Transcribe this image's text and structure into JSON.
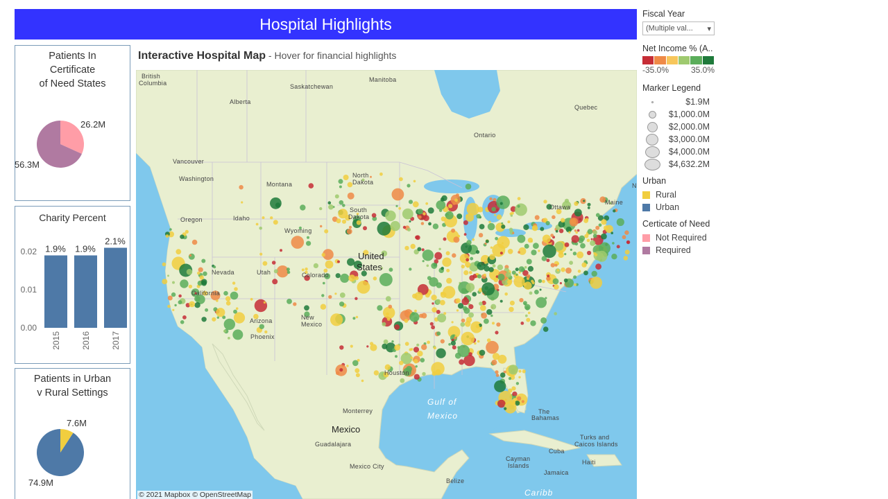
{
  "header": {
    "title": "Hospital Highlights"
  },
  "panels": {
    "certificate": {
      "title_lines": [
        "Patients In",
        "Certificate",
        "of Need States"
      ],
      "slices": [
        {
          "label": "26.2M",
          "value": 26.2,
          "color": "#ff9da7"
        },
        {
          "label": "56.3M",
          "value": 56.3,
          "color": "#b07aa1"
        }
      ]
    },
    "charity": {
      "title": "Charity Percent",
      "y_ticks": [
        "0.02",
        "0.01",
        "0.00"
      ],
      "bars": [
        {
          "year": "2015",
          "value": 0.019,
          "label": "1.9%"
        },
        {
          "year": "2016",
          "value": 0.019,
          "label": "1.9%"
        },
        {
          "year": "2017",
          "value": 0.021,
          "label": "2.1%"
        }
      ],
      "bar_color": "#4e79a7"
    },
    "urban": {
      "title_lines": [
        "Patients in Urban",
        "v Rural Settings"
      ],
      "slices": [
        {
          "label": "7.6M",
          "value": 7.6,
          "color": "#f1ce3f"
        },
        {
          "label": "74.9M",
          "value": 74.9,
          "color": "#4e79a7"
        }
      ]
    }
  },
  "map": {
    "title_bold": "Interactive Hospital Map",
    "title_sub": " - Hover for financial highlights",
    "attribution": "© 2021 Mapbox © OpenStreetMap",
    "labels": {
      "british_columbia_1": "British",
      "british_columbia_2": "Columbia",
      "saskatchewan": "Saskatchewan",
      "manitoba": "Manitoba",
      "alberta": "Alberta",
      "quebec": "Quebec",
      "ontario": "Ontario",
      "vancouver": "Vancouver",
      "washington": "Washington",
      "montana": "Montana",
      "north_dakota_1": "North",
      "north_dakota_2": "Dakota",
      "south_dakota_1": "South",
      "south_dakota_2": "Dakota",
      "oregon": "Oregon",
      "idaho": "Idaho",
      "wyoming": "Wyoming",
      "nevada": "Nevada",
      "utah": "Utah",
      "colorado": "Colorado",
      "arizona": "Arizona",
      "new_mexico_1": "New",
      "new_mexico_2": "Mexico",
      "phoenix": "Phoenix",
      "california": "California",
      "united_states_1": "United",
      "united_states_2": "States",
      "ottawa": "Ottawa",
      "maine": "Maine",
      "houston": "Houston",
      "monterrey": "Monterrey",
      "mexico": "Mexico",
      "guadalajara": "Guadalajara",
      "mexico_city": "Mexico City",
      "gulf_1": "Gulf of",
      "gulf_2": "Mexico",
      "bahamas_1": "The",
      "bahamas_2": "Bahamas",
      "cuba": "Cuba",
      "turks_1": "Turks and",
      "turks_2": "Caicos Islands",
      "haiti": "Haiti",
      "cayman_1": "Cayman",
      "cayman_2": "Islands",
      "jamaica": "Jamaica",
      "belize": "Belize",
      "caribbean": "Caribb",
      "n_label": "N"
    }
  },
  "legend": {
    "fiscal_year": {
      "title": "Fiscal Year",
      "value": "(Multiple val...",
      "arrow": "▾"
    },
    "net_income": {
      "title": "Net Income % (A..",
      "min_label": "-35.0%",
      "max_label": "35.0%",
      "colors": [
        "#c62d36",
        "#ef8a47",
        "#f7c65b",
        "#9fca6f",
        "#5aad5a",
        "#1f7a3b"
      ]
    },
    "marker": {
      "title": "Marker Legend",
      "items": [
        "$1.9M",
        "$1,000.0M",
        "$2,000.0M",
        "$3,000.0M",
        "$4,000.0M",
        "$4,632.2M"
      ]
    },
    "urban": {
      "title": "Urban",
      "items": [
        {
          "label": "Rural",
          "color": "#f1ce3f"
        },
        {
          "label": "Urban",
          "color": "#4e79a7"
        }
      ]
    },
    "con": {
      "title": "Certicate of Need",
      "items": [
        {
          "label": "Not Required",
          "color": "#ff9da7"
        },
        {
          "label": "Required",
          "color": "#b07aa1"
        }
      ]
    }
  }
}
